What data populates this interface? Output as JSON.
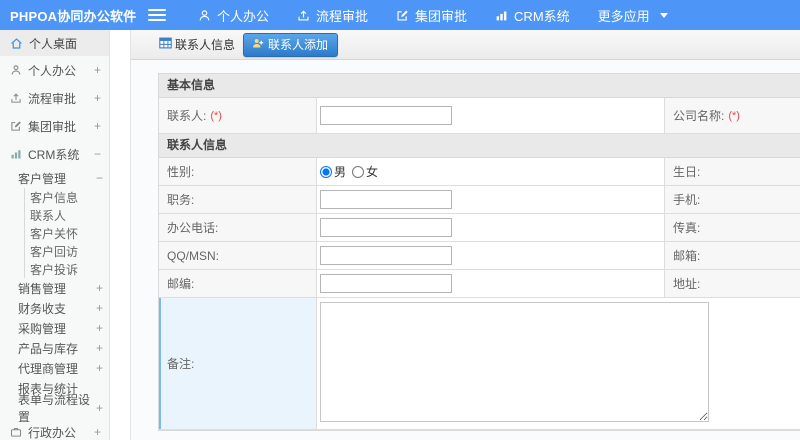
{
  "topbar": {
    "brand": "PHPOA协同办公软件",
    "nav": [
      {
        "label": "个人办公",
        "icon": "user-icon"
      },
      {
        "label": "流程审批",
        "icon": "workflow-icon"
      },
      {
        "label": "集团审批",
        "icon": "edit-icon"
      },
      {
        "label": "CRM系统",
        "icon": "bar-chart-icon"
      },
      {
        "label": "更多应用",
        "icon": "caret-down-icon"
      }
    ]
  },
  "sidebar": {
    "items": [
      {
        "label": "个人桌面",
        "icon": "home-icon"
      },
      {
        "label": "个人办公",
        "icon": "user-icon",
        "toggle": "+"
      },
      {
        "label": "流程审批",
        "icon": "workflow-icon",
        "toggle": "+"
      },
      {
        "label": "集团审批",
        "icon": "edit-icon",
        "toggle": "+"
      },
      {
        "label": "CRM系统",
        "icon": "bar-chart-icon",
        "toggle": "−"
      },
      {
        "label": "客户管理",
        "toggle": "−"
      },
      {
        "label": "客户信息"
      },
      {
        "label": "联系人"
      },
      {
        "label": "客户关怀"
      },
      {
        "label": "客户回访"
      },
      {
        "label": "客户投诉"
      },
      {
        "label": "销售管理",
        "toggle": "+"
      },
      {
        "label": "财务收支",
        "toggle": "+"
      },
      {
        "label": "采购管理",
        "toggle": "+"
      },
      {
        "label": "产品与库存",
        "toggle": "+"
      },
      {
        "label": "代理商管理",
        "toggle": "+"
      },
      {
        "label": "报表与统计"
      },
      {
        "label": "表单与流程设置",
        "toggle": "+"
      },
      {
        "label": "行政办公",
        "icon": "briefcase-icon",
        "toggle": "+"
      }
    ]
  },
  "tabs": [
    {
      "label": "联系人信息",
      "icon": "table-icon",
      "active": false
    },
    {
      "label": "联系人添加",
      "icon": "add-contact-icon",
      "active": true
    }
  ],
  "form": {
    "required_marker": "(*)",
    "sections": [
      {
        "title": "基本信息"
      },
      {
        "title": "联系人信息"
      }
    ],
    "labels": {
      "contact": "联系人:",
      "company": "公司名称:",
      "gender": "性别:",
      "birthday": "生日:",
      "job_title": "职务:",
      "mobile": "手机:",
      "office_phone": "办公电话:",
      "fax": "传真:",
      "qq_msn": "QQ/MSN:",
      "email": "邮箱:",
      "zip": "邮编:",
      "address": "地址:",
      "remark": "备注:"
    },
    "gender_options": [
      "男",
      "女"
    ],
    "gender_selected": "男",
    "values": {
      "contact": "",
      "job_title": "",
      "office_phone": "",
      "qq_msn": "",
      "zip": "",
      "remark": ""
    },
    "colors": {
      "topbar": "#4d96f7",
      "active_tab": "#2d7ac9",
      "required": "#e14b4b",
      "remark_highlight": "#e9f4fd"
    }
  }
}
